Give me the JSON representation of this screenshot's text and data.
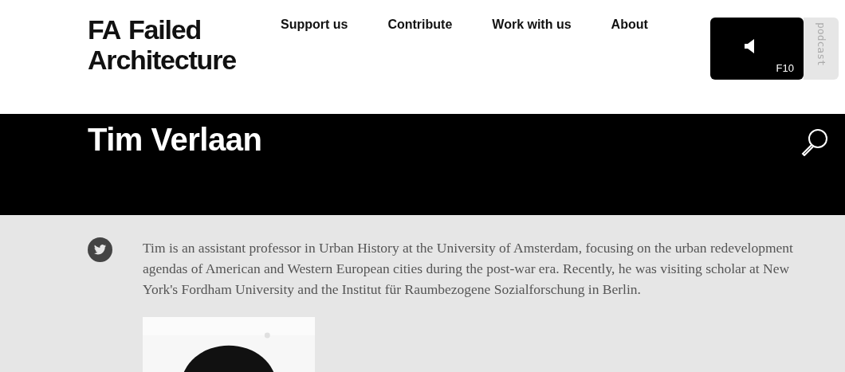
{
  "logo": {
    "mark": "FA",
    "lines": [
      "Failed",
      "Architecture"
    ]
  },
  "nav": [
    {
      "label": "Support us"
    },
    {
      "label": "Contribute"
    },
    {
      "label": "Work with us"
    },
    {
      "label": "About"
    }
  ],
  "podcast": {
    "key": "F10",
    "label": "podcast"
  },
  "page_title": "Tim Verlaan",
  "bio": "Tim is an assistant professor in Urban History at the University of Amsterdam, focusing on the urban redevelopment agendas of American and Western European cities during the post-war era. Recently, he was visiting scholar at New York's Fordham University and the Institut für Raumbezogene Sozialforschung in Berlin."
}
